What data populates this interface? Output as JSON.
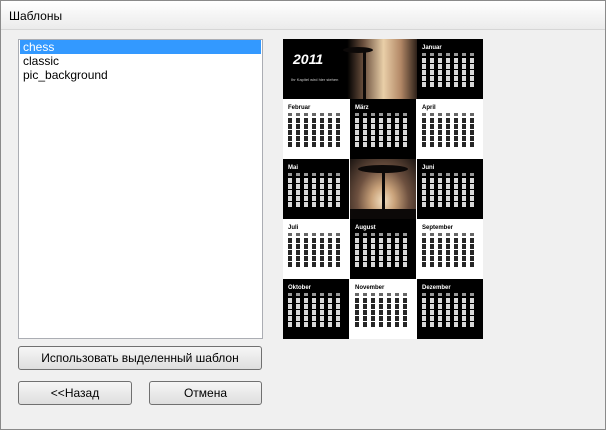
{
  "window": {
    "title": "Шаблоны"
  },
  "templates": [
    {
      "name": "chess",
      "selected": true
    },
    {
      "name": "classic",
      "selected": false
    },
    {
      "name": "pic_background",
      "selected": false
    }
  ],
  "buttons": {
    "use_selected": "Использовать выделенный шаблон",
    "back": "<<Назад",
    "cancel": "Отмена"
  },
  "preview": {
    "year": "2011",
    "year_subtitle": "Ihr Kapitel wird hier stehen",
    "months": [
      "Januar",
      "Februar",
      "März",
      "April",
      "Mai",
      "Juni",
      "Juli",
      "August",
      "September",
      "Oktober",
      "November",
      "Dezember"
    ]
  }
}
